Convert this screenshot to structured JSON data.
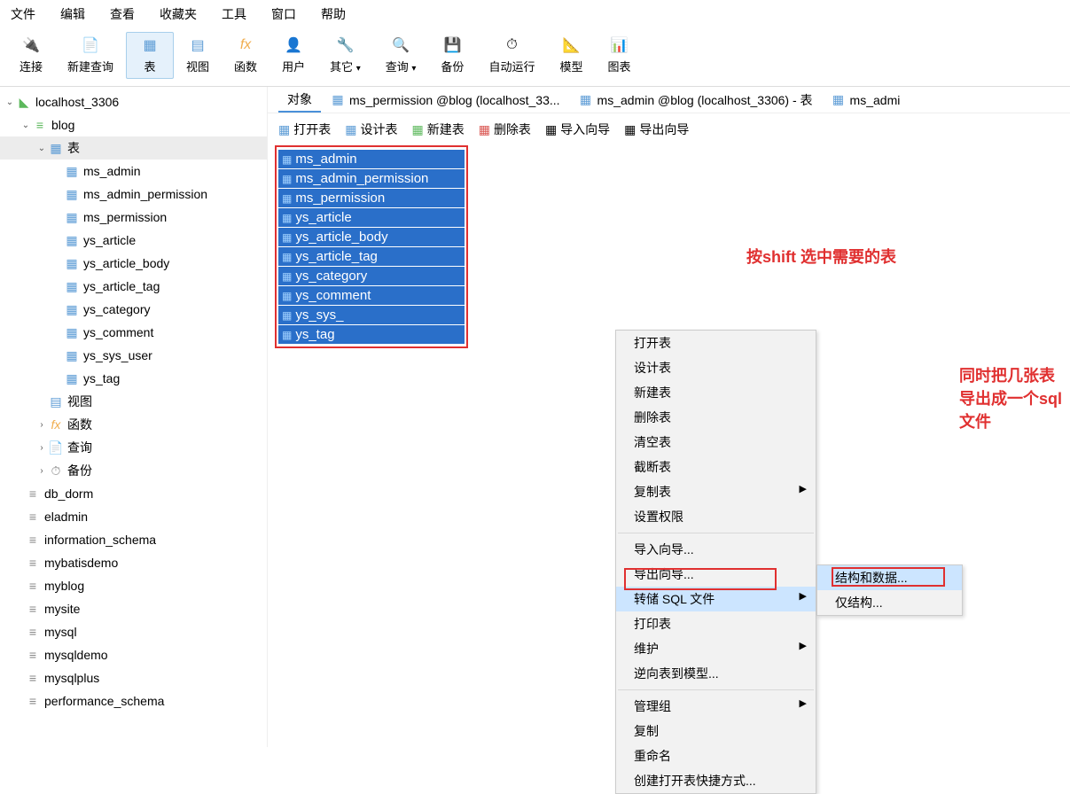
{
  "menu": {
    "file": "文件",
    "edit": "编辑",
    "view": "查看",
    "fav": "收藏夹",
    "tools": "工具",
    "window": "窗口",
    "help": "帮助"
  },
  "toolbar": {
    "connect": "连接",
    "newquery": "新建查询",
    "table": "表",
    "view": "视图",
    "func": "函数",
    "user": "用户",
    "other": "其它",
    "query": "查询",
    "backup": "备份",
    "auto": "自动运行",
    "model": "模型",
    "chart": "图表"
  },
  "tree": {
    "conn": "localhost_3306",
    "blog": "blog",
    "tables_node": "表",
    "tables": [
      "ms_admin",
      "ms_admin_permission",
      "ms_permission",
      "ys_article",
      "ys_article_body",
      "ys_article_tag",
      "ys_category",
      "ys_comment",
      "ys_sys_user",
      "ys_tag"
    ],
    "view": "视图",
    "func": "函数",
    "query": "查询",
    "backup": "备份",
    "dbs": [
      "db_dorm",
      "eladmin",
      "information_schema",
      "mybatisdemo",
      "myblog",
      "mysite",
      "mysql",
      "mysqldemo",
      "mysqlplus",
      "performance_schema"
    ]
  },
  "tabs": {
    "obj": "对象",
    "t1": "ms_permission @blog (localhost_33...",
    "t2": "ms_admin @blog (localhost_3306) - 表",
    "t3": "ms_admi"
  },
  "subbar": {
    "open": "打开表",
    "design": "设计表",
    "new": "新建表",
    "del": "删除表",
    "imp": "导入向导",
    "exp": "导出向导"
  },
  "selected": [
    "ms_admin",
    "ms_admin_permission",
    "ms_permission",
    "ys_article",
    "ys_article_body",
    "ys_article_tag",
    "ys_category",
    "ys_comment",
    "ys_sys_",
    "ys_tag"
  ],
  "annotation1": "按shift 选中需要的表",
  "annotation2": "同时把几张表导出成一个sql文件",
  "ctx": {
    "open": "打开表",
    "design": "设计表",
    "new": "新建表",
    "del": "删除表",
    "empty": "清空表",
    "trunc": "截断表",
    "copy": "复制表",
    "perm": "设置权限",
    "impw": "导入向导...",
    "expw": "导出向导...",
    "dump": "转储 SQL 文件",
    "print": "打印表",
    "maint": "维护",
    "rev": "逆向表到模型...",
    "grp": "管理组",
    "cp": "复制",
    "rename": "重命名",
    "shortcut": "创建打开表快捷方式..."
  },
  "sub": {
    "sd": "结构和数据...",
    "so": "仅结构..."
  }
}
